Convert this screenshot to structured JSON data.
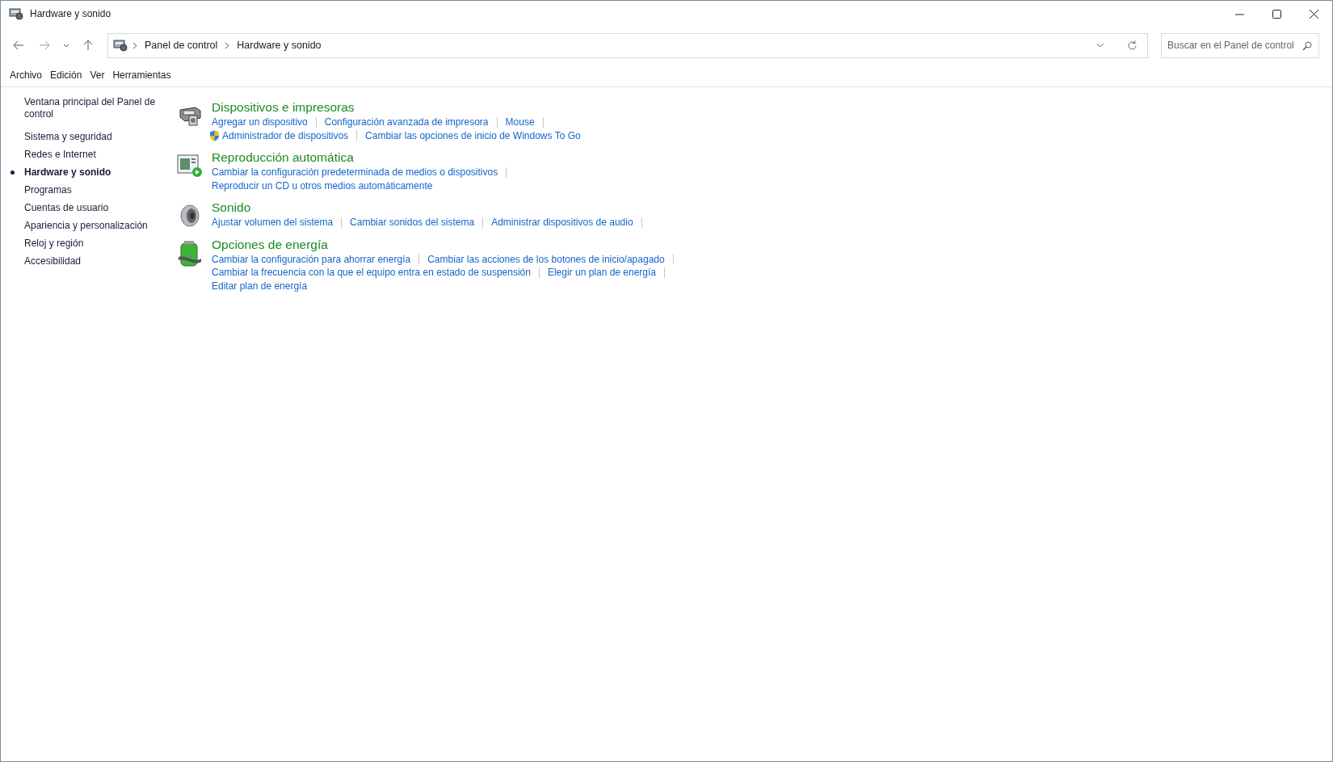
{
  "window": {
    "title": "Hardware y sonido"
  },
  "navigation": {
    "breadcrumb": [
      "Panel de control",
      "Hardware y sonido"
    ]
  },
  "search": {
    "placeholder": "Buscar en el Panel de control"
  },
  "menu": [
    "Archivo",
    "Edición",
    "Ver",
    "Herramientas"
  ],
  "sidebar": {
    "items": [
      {
        "label": "Ventana principal del Panel de control",
        "selected": false
      },
      {
        "label": "Sistema y seguridad",
        "selected": false
      },
      {
        "label": "Redes e Internet",
        "selected": false
      },
      {
        "label": "Hardware y sonido",
        "selected": true
      },
      {
        "label": "Programas",
        "selected": false
      },
      {
        "label": "Cuentas de usuario",
        "selected": false
      },
      {
        "label": "Apariencia y personalización",
        "selected": false
      },
      {
        "label": "Reloj y región",
        "selected": false
      },
      {
        "label": "Accesibilidad",
        "selected": false
      }
    ]
  },
  "sections": [
    {
      "kind": "printer",
      "title": "Dispositivos e impresoras",
      "lines": [
        [
          {
            "text": "Agregar un dispositivo",
            "shield": false
          },
          {
            "text": "Configuración avanzada de impresora",
            "shield": false
          },
          {
            "text": "Mouse",
            "shield": false
          }
        ],
        [
          {
            "text": "Administrador de dispositivos",
            "shield": true
          },
          {
            "text": "Cambiar las opciones de inicio de Windows To Go",
            "shield": false
          }
        ]
      ]
    },
    {
      "kind": "autoplay",
      "title": "Reproducción automática",
      "lines": [
        [
          {
            "text": "Cambiar la configuración predeterminada de medios o dispositivos",
            "shield": false
          }
        ],
        [
          {
            "text": "Reproducir un CD u otros medios automáticamente",
            "shield": false
          }
        ]
      ]
    },
    {
      "kind": "speaker",
      "title": "Sonido",
      "lines": [
        [
          {
            "text": "Ajustar volumen del sistema",
            "shield": false
          },
          {
            "text": "Cambiar sonidos del sistema",
            "shield": false
          },
          {
            "text": "Administrar dispositivos de audio",
            "shield": false
          }
        ]
      ]
    },
    {
      "kind": "battery",
      "title": "Opciones de energía",
      "lines": [
        [
          {
            "text": "Cambiar la configuración para ahorrar energía",
            "shield": false
          },
          {
            "text": "Cambiar las acciones de los botones de inicio/apagado",
            "shield": false
          }
        ],
        [
          {
            "text": "Cambiar la frecuencia con la que el equipo entra en estado de suspensión",
            "shield": false
          },
          {
            "text": "Elegir un plan de energía",
            "shield": false
          }
        ],
        [
          {
            "text": "Editar plan de energía",
            "shield": false
          }
        ]
      ]
    }
  ]
}
